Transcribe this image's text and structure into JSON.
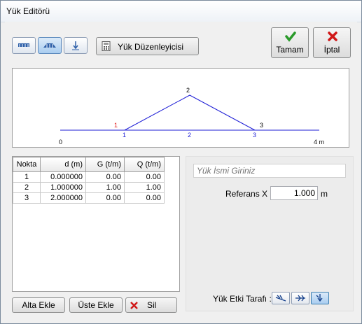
{
  "window": {
    "title": "Yük Editörü"
  },
  "toolbar": {
    "editor_label": "Yük Düzenleyicisi",
    "ok_label": "Tamam",
    "cancel_label": "İptal"
  },
  "diagram": {
    "axis_start": "0",
    "axis_end": "4 m",
    "vertex_labels": [
      "1",
      "2",
      "3"
    ],
    "segment_labels": [
      "1",
      "2",
      "3"
    ],
    "red_label": "1"
  },
  "table": {
    "headers": [
      "Nokta",
      "d (m)",
      "G (t/m)",
      "Q (t/m)"
    ],
    "rows": [
      [
        "1",
        "0.000000",
        "0.00",
        "0.00"
      ],
      [
        "2",
        "1.000000",
        "1.00",
        "1.00"
      ],
      [
        "3",
        "2.000000",
        "0.00",
        "0.00"
      ]
    ]
  },
  "buttons": {
    "add_below": "Alta Ekle",
    "add_above": "Üste Ekle",
    "delete": "Sil"
  },
  "right_panel": {
    "name_placeholder": "Yük İsmi Giriniz",
    "reference_label": "Referans X :",
    "reference_value": "1.000",
    "reference_unit": "m",
    "side_label": "Yük Etki Tarafı :"
  },
  "colors": {
    "accent_blue": "#1f1fd6",
    "ok_green": "#2a9a2a",
    "cancel_red": "#d01818",
    "label_red": "#e11b1b"
  }
}
